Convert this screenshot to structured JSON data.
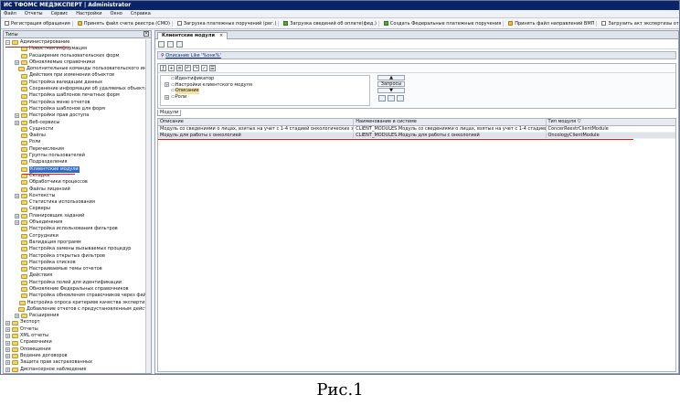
{
  "window": {
    "title": "ИС ТФОМС МЕДЭКСПЕРТ | Administrator"
  },
  "menu": [
    "Файл",
    "Отчеты",
    "Сервис",
    "Настройки",
    "Окно",
    "Справка"
  ],
  "toolbar": [
    "Регистрация обращения",
    "Принять файл счета реестра (СМО)",
    "Загрузка платежных поручений (рег.)",
    "Загрузка сведений об оплате(фед.)",
    "Создать Федеральные платежные поручения",
    "Принять файл направлений ВМП",
    "Загрузить акт экспертизы от СМО",
    "Импортировать результаты эк"
  ],
  "left_panel": {
    "title": "Типы",
    "tree": [
      {
        "label": "Администрирование",
        "level": 0,
        "exp": "−"
      },
      {
        "label": "Новостная информация",
        "level": 1
      },
      {
        "label": "Расширение пользовательских форм",
        "level": 1
      },
      {
        "label": "Обновляемые справочники",
        "level": 1,
        "exp": "+"
      },
      {
        "label": "Дополнительные команды пользовательского интерфе",
        "level": 1
      },
      {
        "label": "Действия при изменении объектов",
        "level": 1
      },
      {
        "label": "Настройка валидации данных",
        "level": 1
      },
      {
        "label": "Сохранение информации об удаляемых объектах",
        "level": 1
      },
      {
        "label": "Настройка шаблонов печатных форм",
        "level": 1
      },
      {
        "label": "Настройка меню отчетов",
        "level": 1
      },
      {
        "label": "Настройка шаблонов для форм",
        "level": 1
      },
      {
        "label": "Настройки прав доступа",
        "level": 1,
        "exp": "+"
      },
      {
        "label": "Веб-сервисы",
        "level": 1,
        "exp": "+"
      },
      {
        "label": "Сущности",
        "level": 1
      },
      {
        "label": "Файлы",
        "level": 1
      },
      {
        "label": "Роли",
        "level": 1
      },
      {
        "label": "Перечисления",
        "level": 1
      },
      {
        "label": "Группы пользователей",
        "level": 1
      },
      {
        "label": "Подразделения",
        "level": 1
      },
      {
        "label": "Клиентские модули",
        "level": 1,
        "selected": true
      },
      {
        "label": "Складки",
        "level": 1
      },
      {
        "label": "Обработчики процессов",
        "level": 1
      },
      {
        "label": "Файлы лицензий",
        "level": 1
      },
      {
        "label": "Контексты",
        "level": 1,
        "exp": "+"
      },
      {
        "label": "Статистика использования",
        "level": 1
      },
      {
        "label": "Серверы",
        "level": 1
      },
      {
        "label": "Планировщик заданий",
        "level": 1,
        "exp": "+"
      },
      {
        "label": "Объединения",
        "level": 1,
        "exp": "+"
      },
      {
        "label": "Настройка использования фильтров",
        "level": 1
      },
      {
        "label": "Сотрудники",
        "level": 1
      },
      {
        "label": "Валидация программ",
        "level": 1
      },
      {
        "label": "Настройка замены вызываемых процедур",
        "level": 1
      },
      {
        "label": "Настройка открытых фильтров",
        "level": 1
      },
      {
        "label": "Настройка списков",
        "level": 1
      },
      {
        "label": "Настраиваемые темы отчетов",
        "level": 1
      },
      {
        "label": "Действия",
        "level": 1
      },
      {
        "label": "Настройка полей для идентификации",
        "level": 1
      },
      {
        "label": "Обновление Федеральных справочников",
        "level": 1
      },
      {
        "label": "Настройка обновления справочников через файл",
        "level": 1
      },
      {
        "label": "Настройка опроса критериев качества экспертизы",
        "level": 1
      },
      {
        "label": "Добавление отчетов с предустановленным действием",
        "level": 1
      },
      {
        "label": "Расширения",
        "level": 1,
        "exp": "+"
      },
      {
        "label": "Экспорт",
        "level": 0,
        "exp": "+"
      },
      {
        "label": "Отчеты",
        "level": 0,
        "exp": "+"
      },
      {
        "label": "XML отчеты",
        "level": 0,
        "exp": "+"
      },
      {
        "label": "Справочники",
        "level": 0,
        "exp": "+"
      },
      {
        "label": "Оповещения",
        "level": 0,
        "exp": "+"
      },
      {
        "label": "Ведение договоров",
        "level": 0,
        "exp": "+"
      },
      {
        "label": "Защита прав застрахованных",
        "level": 0,
        "exp": "+"
      },
      {
        "label": "Диспансерное наблюдение",
        "level": 0,
        "exp": "+"
      }
    ]
  },
  "right_panel": {
    "tab": "Клиентские модули",
    "tab_close": "×",
    "description": "Описание Like '%онк%'",
    "props_tree": [
      {
        "label": "Идентификатор",
        "exp": ""
      },
      {
        "label": "Настройки клиентского модуля",
        "exp": "+"
      },
      {
        "label": "Описание",
        "exp": "",
        "hl": true
      },
      {
        "label": "Роли",
        "exp": "+"
      }
    ],
    "spin_label": "Запросы",
    "props_tab": "Модули",
    "grid": {
      "columns": [
        "Описание",
        "Наименование в системе",
        "Тип модуля"
      ],
      "rows": [
        [
          "Модуль со сведениями о лицах, взятых на учет с 1-4 стадией онкологических заболеван",
          "CLIENT_MODULES.Модуль со сведениями о лицах, взятых на учет с 1-4 стадией онкол",
          "ConcerReestrClientModule"
        ],
        [
          "Модуль для работы с онкологией",
          "CLIENT_MODULES.Модуль для работы с онкологией",
          "OncologyClientModule"
        ]
      ]
    }
  },
  "caption": "Рис.1",
  "colors": {
    "accent": "#0a246a",
    "selection": "#316ac5",
    "underline": "#d81a1a"
  }
}
